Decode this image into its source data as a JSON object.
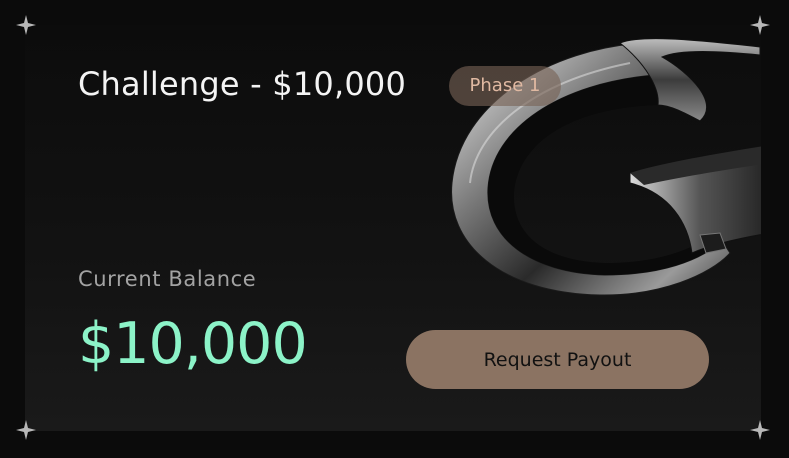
{
  "card": {
    "title": "Challenge - $10,000",
    "phase_badge": "Phase 1",
    "balance_label": "Current Balance",
    "balance_value": "$10,000",
    "payout_button_label": "Request Payout"
  },
  "colors": {
    "background": "#0b0b0b",
    "balance_accent": "#8cf3c8",
    "button": "#8b7362",
    "badge_bg": "#786256",
    "badge_text": "#e0b9a2"
  },
  "icons": {
    "corner": "sparkle-icon",
    "decoration": "chrome-g-logo"
  }
}
